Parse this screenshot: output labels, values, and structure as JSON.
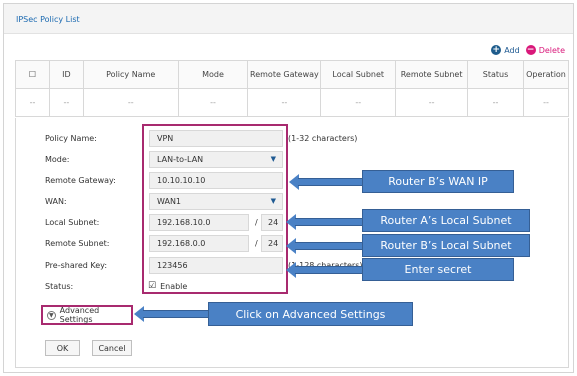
{
  "page": {
    "title": "IPSec Policy List"
  },
  "toolbar": {
    "add_label": "Add",
    "delete_label": "Delete"
  },
  "table": {
    "columns": [
      "",
      "ID",
      "Policy Name",
      "Mode",
      "Remote Gateway",
      "Local Subnet",
      "Remote Subnet",
      "Status",
      "Operation"
    ],
    "blank_row": [
      "--",
      "--",
      "--",
      "--",
      "--",
      "--",
      "--",
      "--",
      "--"
    ]
  },
  "form": {
    "policy_name_label": "Policy Name:",
    "policy_name_value": "VPN",
    "policy_name_hint": "(1-32 characters)",
    "mode_label": "Mode:",
    "mode_value": "LAN-to-LAN",
    "remote_gateway_label": "Remote Gateway:",
    "remote_gateway_value": "10.10.10.10",
    "wan_label": "WAN:",
    "wan_value": "WAN1",
    "local_subnet_label": "Local Subnet:",
    "local_subnet_value": "192.168.10.0",
    "local_subnet_mask": "24",
    "remote_subnet_label": "Remote Subnet:",
    "remote_subnet_value": "192.168.0.0",
    "remote_subnet_mask": "24",
    "slash": "/",
    "psk_label": "Pre-shared Key:",
    "psk_value": "123456",
    "psk_hint": "(1-128 characters)",
    "status_label": "Status:",
    "status_check": "Enable",
    "advanced_label": "Advanced Settings",
    "ok_label": "OK",
    "cancel_label": "Cancel"
  },
  "callouts": {
    "wan_ip": "Router B’s WAN IP",
    "local_subnet": "Router A’s Local Subnet",
    "remote_subnet": "Router B’s Local Subnet",
    "secret": "Enter secret",
    "advanced": "Click on Advanced Settings"
  },
  "colors": {
    "accent": "#1c6ab1",
    "delete": "#d9187a",
    "highlight": "#a82a6f",
    "callout": "#4a81c5"
  }
}
